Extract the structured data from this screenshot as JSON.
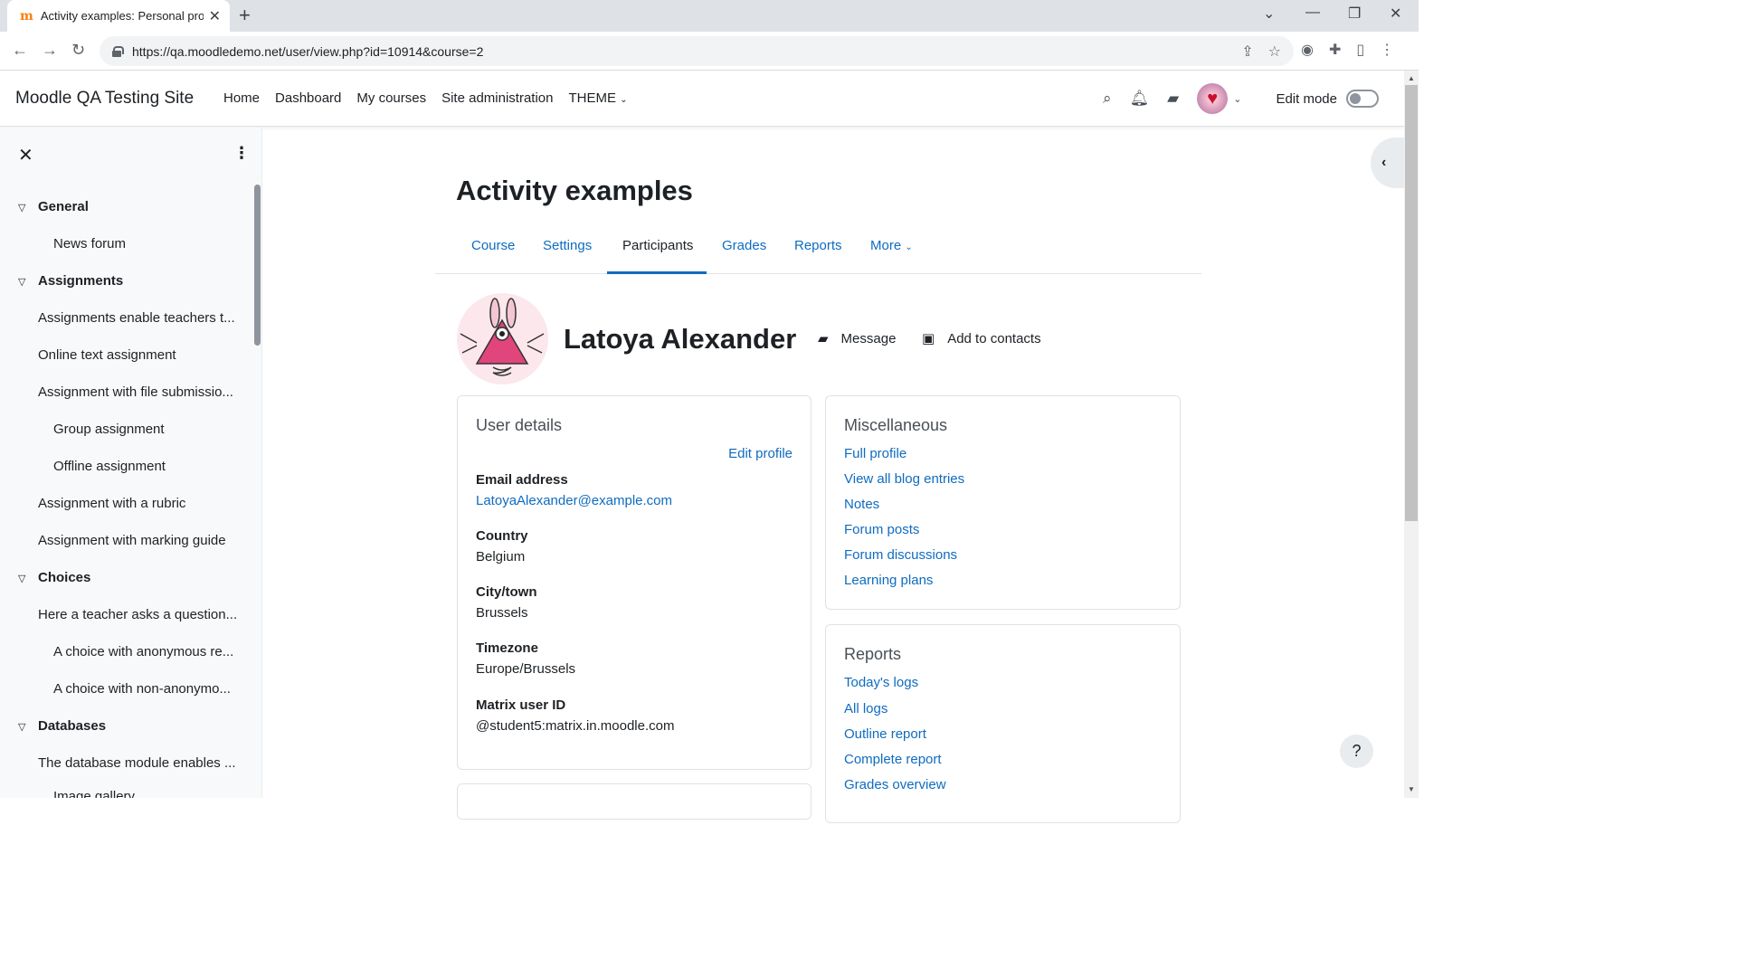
{
  "browser": {
    "tab_title": "Activity examples: Personal profil",
    "tab_favicon": "m",
    "url": "https://qa.moodledemo.net/user/view.php?id=10914&course=2"
  },
  "site": {
    "name": "Moodle QA Testing Site",
    "nav": [
      "Home",
      "Dashboard",
      "My courses",
      "Site administration",
      "THEME"
    ],
    "edit_mode_label": "Edit mode"
  },
  "drawer": {
    "items": [
      {
        "label": "General",
        "section": true
      },
      {
        "label": "News forum",
        "indent": 2
      },
      {
        "label": "Assignments",
        "section": true
      },
      {
        "label": "Assignments enable teachers t...",
        "indent": 1
      },
      {
        "label": "Online text assignment",
        "indent": 1
      },
      {
        "label": "Assignment with file submissio...",
        "indent": 1
      },
      {
        "label": "Group assignment",
        "indent": 2
      },
      {
        "label": "Offline assignment",
        "indent": 2
      },
      {
        "label": "Assignment with a rubric",
        "indent": 1
      },
      {
        "label": "Assignment with marking guide",
        "indent": 1
      },
      {
        "label": "Choices",
        "section": true
      },
      {
        "label": "Here a teacher asks a question...",
        "indent": 1
      },
      {
        "label": "A choice with anonymous re...",
        "indent": 2
      },
      {
        "label": "A choice with non-anonymo...",
        "indent": 2
      },
      {
        "label": "Databases",
        "section": true
      },
      {
        "label": "The database module enables ...",
        "indent": 1
      },
      {
        "label": "Image gallery",
        "indent": 2
      }
    ]
  },
  "course": {
    "title": "Activity examples",
    "tabs": [
      "Course",
      "Settings",
      "Participants",
      "Grades",
      "Reports",
      "More"
    ],
    "active_tab": "Participants"
  },
  "profile": {
    "name": "Latoya Alexander",
    "message_label": "Message",
    "add_contacts_label": "Add to contacts"
  },
  "user_details": {
    "title": "User details",
    "edit_profile": "Edit profile",
    "fields": [
      {
        "term": "Email address",
        "value": "LatoyaAlexander@example.com",
        "link": true
      },
      {
        "term": "Country",
        "value": "Belgium"
      },
      {
        "term": "City/town",
        "value": "Brussels"
      },
      {
        "term": "Timezone",
        "value": "Europe/Brussels"
      },
      {
        "term": "Matrix user ID",
        "value": "@student5:matrix.in.moodle.com"
      }
    ]
  },
  "miscellaneous": {
    "title": "Miscellaneous",
    "links": [
      "Full profile",
      "View all blog entries",
      "Notes",
      "Forum posts",
      "Forum discussions",
      "Learning plans"
    ]
  },
  "reports": {
    "title": "Reports",
    "links": [
      "Today's logs",
      "All logs",
      "Outline report",
      "Complete report",
      "Grades overview"
    ]
  },
  "help_label": "?",
  "colors": {
    "link": "#0f6cbf",
    "text": "#1d2125",
    "drawer_bg": "#f8f9fa"
  }
}
